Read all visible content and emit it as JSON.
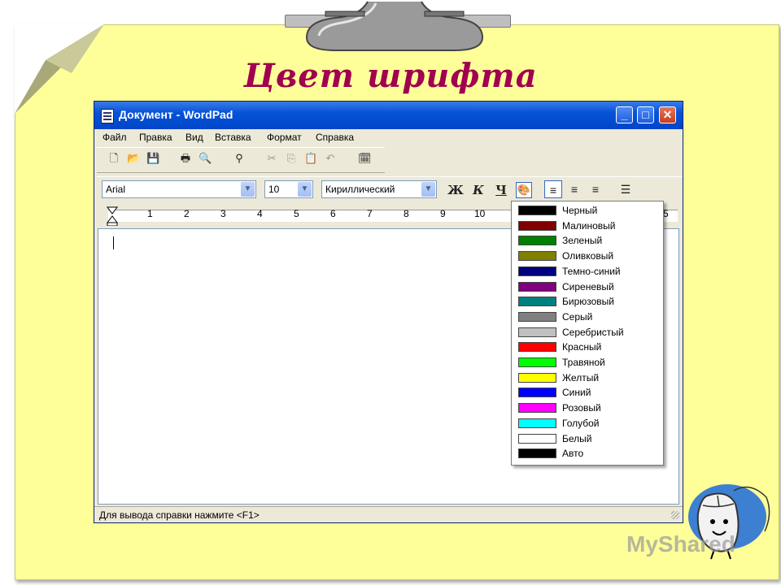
{
  "slide": {
    "title": "Цвет шрифта",
    "watermark": "MyShared",
    "colors": {
      "paper": "#ffff99",
      "title": "#a0004f"
    }
  },
  "window": {
    "title": "Документ - WordPad",
    "controls": {
      "minimize": "_",
      "maximize": "□",
      "close": "✕"
    },
    "menu": [
      "Файл",
      "Правка",
      "Вид",
      "Вставка",
      "Формат",
      "Справка"
    ],
    "toolbar": {
      "icons": [
        "new-icon",
        "open-icon",
        "save-icon",
        "print-icon",
        "print-preview-icon",
        "find-icon",
        "cut-icon",
        "copy-icon",
        "paste-icon",
        "undo-icon",
        "datetime-icon"
      ]
    },
    "format_bar": {
      "font": "Arial",
      "size": "10",
      "script": "Кириллический",
      "bold": "Ж",
      "italic": "К",
      "underline": "Ч"
    },
    "ruler": {
      "numbers": [
        "1",
        "2",
        "3",
        "4",
        "5",
        "6",
        "7",
        "8",
        "9",
        "10",
        "5"
      ]
    },
    "status_text": "Для вывода справки нажмите <F1>"
  },
  "color_menu": {
    "items": [
      {
        "label": "Черный",
        "color": "#000000"
      },
      {
        "label": "Малиновый",
        "color": "#800000"
      },
      {
        "label": "Зеленый",
        "color": "#008000"
      },
      {
        "label": "Оливковый",
        "color": "#808000"
      },
      {
        "label": "Темно-синий",
        "color": "#000080"
      },
      {
        "label": "Сиреневый",
        "color": "#800080"
      },
      {
        "label": "Бирюзовый",
        "color": "#008080"
      },
      {
        "label": "Серый",
        "color": "#808080"
      },
      {
        "label": "Серебристый",
        "color": "#c0c0c0"
      },
      {
        "label": "Красный",
        "color": "#ff0000"
      },
      {
        "label": "Травяной",
        "color": "#00ff00"
      },
      {
        "label": "Желтый",
        "color": "#ffff00"
      },
      {
        "label": "Синий",
        "color": "#0000ff"
      },
      {
        "label": "Розовый",
        "color": "#ff00ff"
      },
      {
        "label": "Голубой",
        "color": "#00ffff"
      },
      {
        "label": "Белый",
        "color": "#ffffff"
      },
      {
        "label": "Авто",
        "color": "#000000"
      }
    ]
  }
}
